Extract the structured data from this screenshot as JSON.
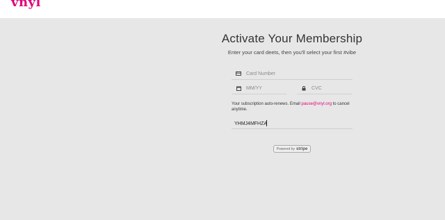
{
  "brand": {
    "logo_text": "vnyl",
    "accent_color": "#e0007a"
  },
  "form": {
    "title": "Activate Your Membership",
    "subtitle": "Enter your card deets, then you'll select your first #vibe",
    "card_number_placeholder": "Card Number",
    "expiry_placeholder": "MM/YY",
    "cvc_placeholder": "CVC",
    "note_prefix": "Your subscription auto-renews. Email ",
    "note_email": "pause@vnyl.org",
    "note_suffix": " to cancel anytime.",
    "promo_code_value": "YHMJ4MFHZA"
  },
  "stripe": {
    "powered_by": "Powered by",
    "brand": "stripe"
  },
  "icons": {
    "card": "credit-card-icon",
    "calendar": "calendar-icon",
    "lock": "lock-icon"
  }
}
